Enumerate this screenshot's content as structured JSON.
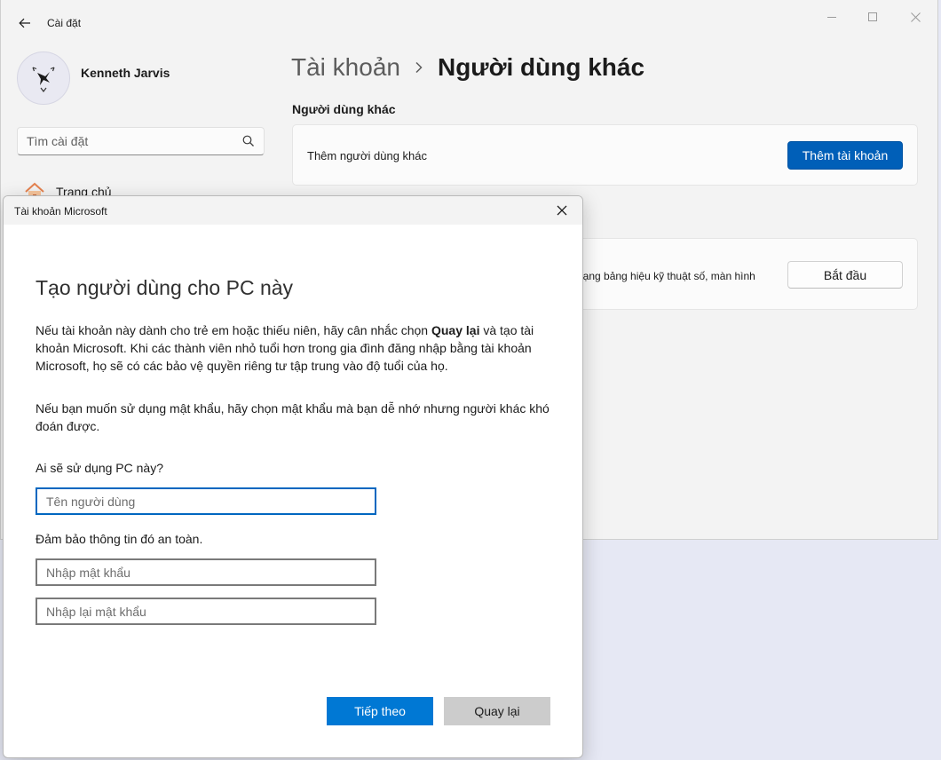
{
  "app": {
    "title": "Cài đặt"
  },
  "user": {
    "name": "Kenneth Jarvis"
  },
  "search": {
    "placeholder": "Tìm cài đặt"
  },
  "nav": {
    "home_label": "Trang chủ"
  },
  "breadcrumb": {
    "parent": "Tài khoản",
    "current": "Người dùng khác"
  },
  "section": {
    "title": "Người dùng khác"
  },
  "add_user_card": {
    "text": "Thêm người dùng khác",
    "button": "Thêm tài khoản"
  },
  "kiosk_card": {
    "text": "dạng bảng hiệu kỹ thuật số, màn hình",
    "button": "Bắt đầu"
  },
  "dialog": {
    "title": "Tài khoản Microsoft",
    "heading": "Tạo người dùng cho PC này",
    "para1_before": "Nếu tài khoản này dành cho trẻ em hoặc thiếu niên, hãy cân nhắc chọn ",
    "para1_bold": "Quay lại",
    "para1_after": " và tạo tài khoản Microsoft. Khi các thành viên nhỏ tuổi hơn trong gia đình đăng nhập bằng tài khoản Microsoft, họ sẽ có các bảo vệ quyền riêng tư tập trung vào độ tuổi của họ.",
    "para2": "Nếu bạn muốn sử dụng mật khẩu, hãy chọn mật khẩu mà bạn dễ nhớ nhưng người khác khó đoán được.",
    "who_label": "Ai sẽ sử dụng PC này?",
    "username_placeholder": "Tên người dùng",
    "secure_label": "Đảm bảo thông tin đó an toàn.",
    "password_placeholder": "Nhập mật khẩu",
    "password_confirm_placeholder": "Nhập lại mật khẩu",
    "next_button": "Tiếp theo",
    "back_button": "Quay lại"
  },
  "colors": {
    "accent": "#005fb8",
    "dialog_accent": "#0078d4",
    "focus_border": "#0067c0"
  }
}
